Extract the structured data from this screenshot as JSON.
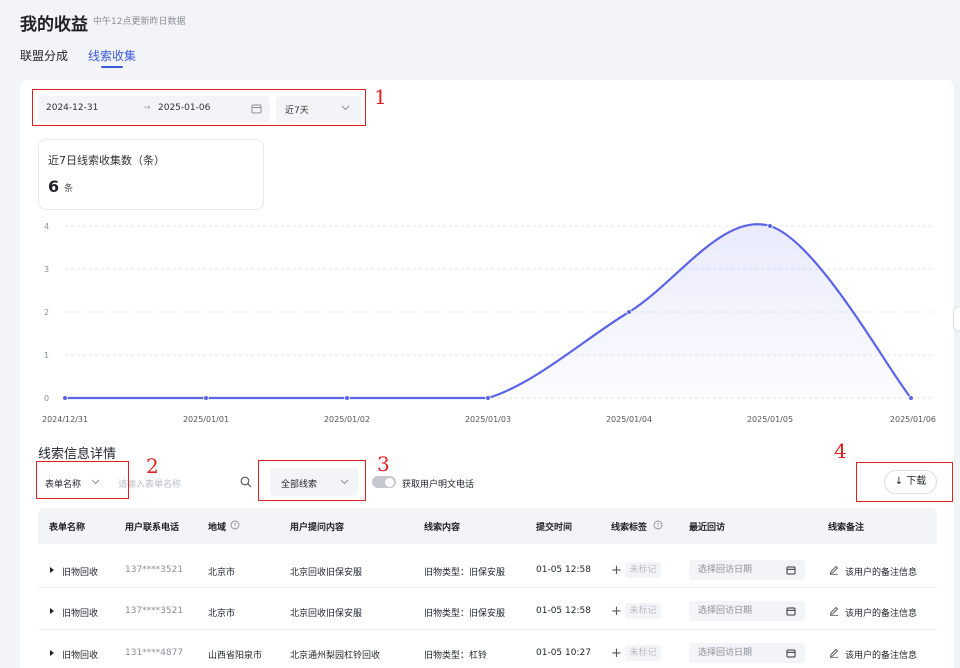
{
  "header": {
    "title": "我的收益",
    "subtitle": "中午12点更新昨日数据"
  },
  "tabs": [
    {
      "label": "联盟分成"
    },
    {
      "label": "线索收集",
      "active": true
    }
  ],
  "date_range": {
    "start": "2024-12-31",
    "separator": "→",
    "end": "2025-01-06",
    "period": "近7天"
  },
  "annotations": [
    "1",
    "2",
    "3",
    "4"
  ],
  "stat": {
    "title": "近7日线索收集数（条）",
    "value": "6",
    "unit": "条"
  },
  "chart_data": {
    "type": "area",
    "x": [
      "2024/12/31",
      "2025/01/01",
      "2025/01/02",
      "2025/01/03",
      "2025/01/04",
      "2025/01/05",
      "2025/01/06"
    ],
    "values": [
      0,
      0,
      0,
      0,
      2,
      4,
      0
    ],
    "y_ticks": [
      0,
      1,
      2,
      3,
      4
    ],
    "ylim": [
      0,
      4
    ],
    "grid": true,
    "color": "#5b63e8"
  },
  "details": {
    "title": "线索信息详情",
    "filter_field": "表单名称",
    "search_placeholder": "请输入表单名称",
    "scope": "全部线索",
    "toggle_label": "获取用户明文电话",
    "download_label": "↓ 下载"
  },
  "table": {
    "columns": [
      "表单名称",
      "用户联系电话",
      "地域",
      "用户提问内容",
      "线索内容",
      "提交时间",
      "线索标签",
      "最近回访",
      "线索备注"
    ],
    "tag_add": "+",
    "tag_label": "未标记",
    "visit_placeholder": "选择回访日期",
    "note_placeholder": "该用户的备注信息",
    "rows": [
      {
        "form": "旧物回收",
        "phone": "137****3521",
        "region": "北京市",
        "question": "北京回收旧保安服",
        "content": "旧物类型：旧保安服",
        "time": "01-05 12:58"
      },
      {
        "form": "旧物回收",
        "phone": "137****3521",
        "region": "北京市",
        "question": "北京回收旧保安服",
        "content": "旧物类型：旧保安服",
        "time": "01-05 12:58"
      },
      {
        "form": "旧物回收",
        "phone": "131****4877",
        "region": "山西省阳泉市",
        "question": "北京通州梨园杠铃回收",
        "content": "旧物类型：杠铃",
        "time": "01-05 10:27"
      }
    ]
  },
  "colors": {
    "accent": "#3b5bdb",
    "annotation": "#e02020",
    "line": "#5b63e8"
  }
}
